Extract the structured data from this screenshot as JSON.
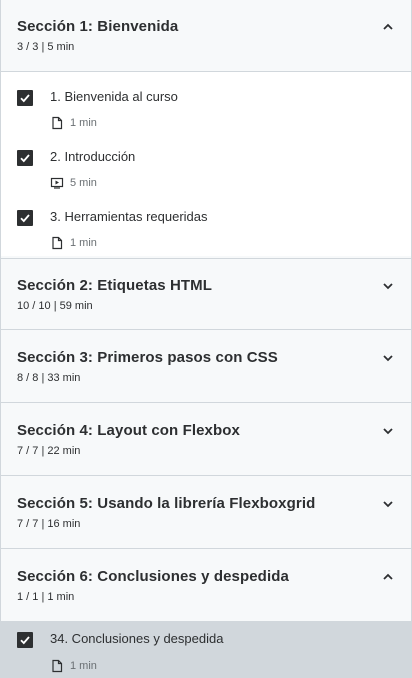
{
  "sections": [
    {
      "title": "Sección 1: Bienvenida",
      "meta": "3 / 3 | 5 min",
      "expanded": true
    },
    {
      "title": "Sección 2: Etiquetas HTML",
      "meta": "10 / 10 | 59 min",
      "expanded": false
    },
    {
      "title": "Sección 3: Primeros pasos con CSS",
      "meta": "8 / 8 | 33 min",
      "expanded": false
    },
    {
      "title": "Sección 4: Layout con Flexbox",
      "meta": "7 / 7 | 22 min",
      "expanded": false
    },
    {
      "title": "Sección 5: Usando la librería Flexboxgrid",
      "meta": "7 / 7 | 16 min",
      "expanded": false
    },
    {
      "title": "Sección 6: Conclusiones y despedida",
      "meta": "1 / 1 | 1 min",
      "expanded": true
    }
  ],
  "section1_items": [
    {
      "title": "1. Bienvenida al curso",
      "duration": "1 min",
      "icon": "document-icon",
      "completed": true
    },
    {
      "title": "2. Introducción",
      "duration": "5 min",
      "icon": "video-icon",
      "completed": true
    },
    {
      "title": "3. Herramientas requeridas",
      "duration": "1 min",
      "icon": "document-icon",
      "completed": true
    }
  ],
  "section6_items": [
    {
      "title": "34. Conclusiones y despedida",
      "duration": "1 min",
      "icon": "document-icon",
      "completed": true,
      "active": true
    }
  ]
}
